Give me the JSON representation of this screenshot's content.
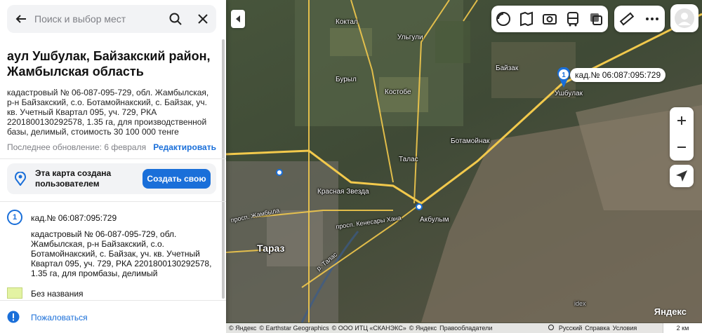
{
  "search": {
    "placeholder": "Поиск и выбор мест"
  },
  "place": {
    "title": "аул Ушбулак, Байзакский район, Жамбылская область",
    "description": "кадастровый № 06-087-095-729, обл. Жамбылская, р-н Байзакский, с.о. Ботамойнакский, с. Байзак, уч. кв. Учетный Квартал 095, уч. 729, РКА 2201800130292578, 1.35 га, для производственной базы, делимый, стоимость 30 100 000 тенге",
    "last_update": "Последнее обновление: 6 февраля",
    "edit_label": "Редактировать"
  },
  "map_owner": {
    "text": "Эта карта создана пользователем",
    "create_label": "Создать свою"
  },
  "points": [
    {
      "number": "1",
      "name": "кад.№ 06:087:095:729",
      "description": "кадастровый № 06-087-095-729, обл. Жамбылская, р-н Байзакский, с.о. Ботамойнакский, с. Байзак, уч. кв. Учетный Квартал 095, уч. 729, РКА 2201800130292578, 1.35 га, для промбазы, делимый"
    }
  ],
  "polygons": [
    {
      "name": "Без названия",
      "color": "#e3f3a3"
    }
  ],
  "complain_label": "Пожаловаться",
  "map": {
    "callout": "кад.№ 06:087:095:729",
    "pin_number": "1",
    "labels": {
      "koktal": "Коктал",
      "ulgili": "Ульгули",
      "baizak": "Байзак",
      "ushbulak": "Ушбулак",
      "buryl": "Бурыл",
      "kostobe": "Костобе",
      "botamoinak": "Ботамойнак",
      "talas": "Талас",
      "krasnaya_zvezda": "Красная Звезда",
      "taraz": "Тараз",
      "akbulym": "Акбулым",
      "prosp_zhambyla": "просп. Жамбыла",
      "prosp_kenesary": "просп. Кенесары Хана",
      "river_talas": "р. Талас",
      "idex": "idex"
    },
    "logo": "Яндекс"
  },
  "attribution": {
    "items": [
      "© Яндекс",
      "© Earthstar Geographics",
      "© ООО ИТЦ «СКАНЭКС»",
      "© Яндекс",
      "Правообладатели"
    ],
    "language": "Русский",
    "help": "Справка",
    "terms": "Условия",
    "scale": "2 км"
  },
  "colors": {
    "accent": "#1a6fd9",
    "road": "#f2c94c"
  }
}
